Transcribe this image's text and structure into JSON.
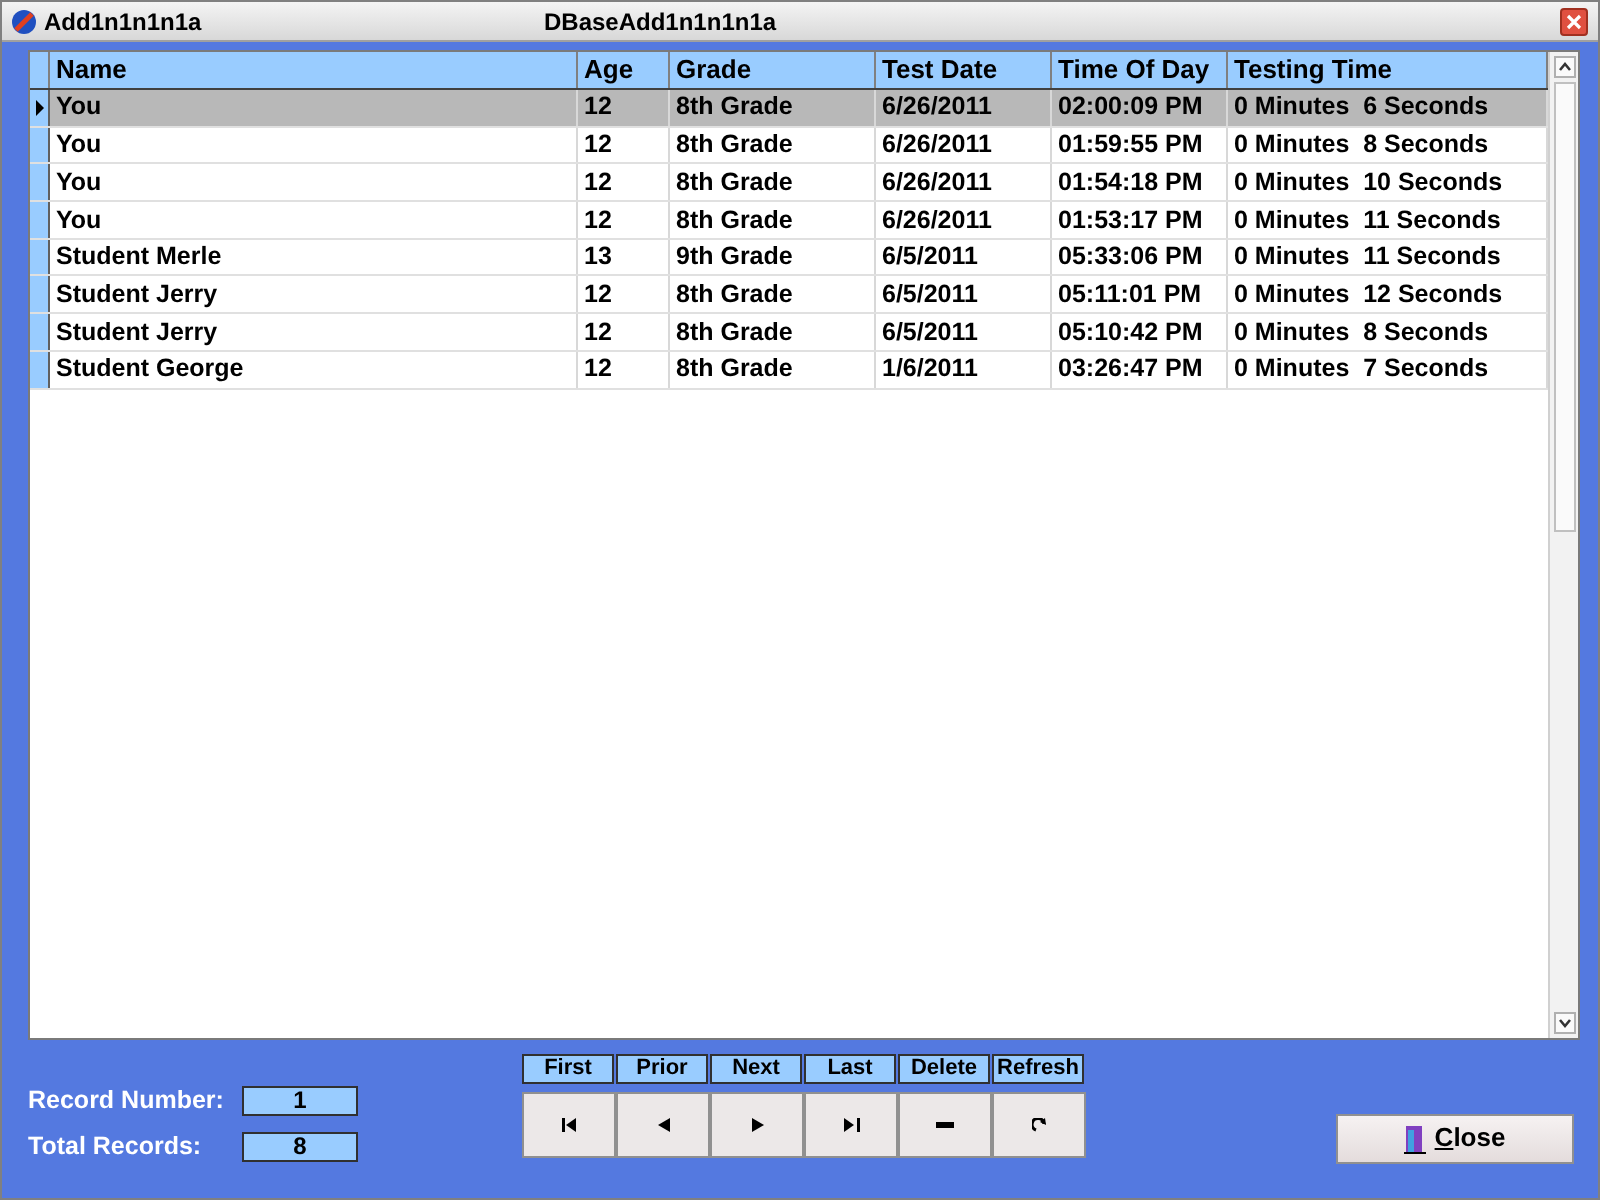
{
  "window": {
    "title": "Add1n1n1n1a",
    "caption": "DBaseAdd1n1n1n1a"
  },
  "table": {
    "columns": [
      "Name",
      "Age",
      "Grade",
      "Test Date",
      "Time Of Day",
      "Testing Time"
    ],
    "rows": [
      {
        "selected": true,
        "cells": [
          "You",
          "12",
          "8th Grade",
          "6/26/2011",
          "02:00:09 PM",
          "0 Minutes  6 Seconds"
        ]
      },
      {
        "selected": false,
        "cells": [
          "You",
          "12",
          "8th Grade",
          "6/26/2011",
          "01:59:55 PM",
          "0 Minutes  8 Seconds"
        ]
      },
      {
        "selected": false,
        "cells": [
          "You",
          "12",
          "8th Grade",
          "6/26/2011",
          "01:54:18 PM",
          "0 Minutes  10 Seconds"
        ]
      },
      {
        "selected": false,
        "cells": [
          "You",
          "12",
          "8th Grade",
          "6/26/2011",
          "01:53:17 PM",
          "0 Minutes  11 Seconds"
        ]
      },
      {
        "selected": false,
        "cells": [
          "Student Merle",
          "13",
          "9th Grade",
          "6/5/2011",
          "05:33:06 PM",
          "0 Minutes  11 Seconds"
        ]
      },
      {
        "selected": false,
        "cells": [
          "Student Jerry",
          "12",
          "8th Grade",
          "6/5/2011",
          "05:11:01 PM",
          "0 Minutes  12 Seconds"
        ]
      },
      {
        "selected": false,
        "cells": [
          "Student Jerry",
          "12",
          "8th Grade",
          "6/5/2011",
          "05:10:42 PM",
          "0 Minutes  8 Seconds"
        ]
      },
      {
        "selected": false,
        "cells": [
          "Student George",
          "12",
          "8th Grade",
          "1/6/2011",
          "03:26:47 PM",
          "0 Minutes  7 Seconds"
        ]
      }
    ]
  },
  "record_info": [
    {
      "label": "Record Number:",
      "value": "1"
    },
    {
      "label": "Total Records:",
      "value": "8"
    }
  ],
  "navigator": [
    {
      "label": "First",
      "kind": "first"
    },
    {
      "label": "Prior",
      "kind": "prior"
    },
    {
      "label": "Next",
      "kind": "next"
    },
    {
      "label": "Last",
      "kind": "last"
    },
    {
      "label": "Delete",
      "kind": "delete"
    },
    {
      "label": "Refresh",
      "kind": "refresh"
    }
  ],
  "close_button": {
    "label": "Close"
  }
}
